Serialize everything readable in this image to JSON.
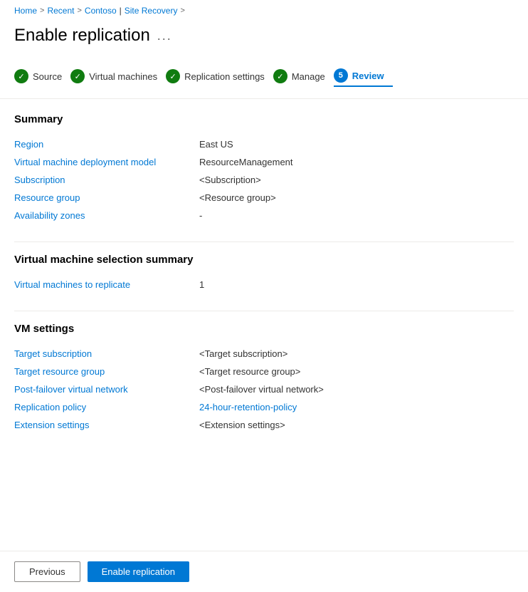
{
  "breadcrumb": {
    "home": "Home",
    "recent": "Recent",
    "contoso": "Contoso",
    "separator": ">",
    "site_recovery": "Site Recovery"
  },
  "page": {
    "title": "Enable replication",
    "menu_icon": "..."
  },
  "wizard": {
    "steps": [
      {
        "id": "source",
        "label": "Source",
        "state": "complete"
      },
      {
        "id": "virtual-machines",
        "label": "Virtual machines",
        "state": "complete"
      },
      {
        "id": "replication-settings",
        "label": "Replication settings",
        "state": "complete"
      },
      {
        "id": "manage",
        "label": "Manage",
        "state": "complete"
      },
      {
        "id": "review",
        "label": "Review",
        "state": "active",
        "number": "5"
      }
    ]
  },
  "summary_section": {
    "header": "Summary",
    "fields": [
      {
        "label": "Region",
        "value": "East US",
        "value_type": "text"
      },
      {
        "label": "Virtual machine deployment model",
        "value": "ResourceManagement",
        "value_type": "text"
      },
      {
        "label": "Subscription",
        "value": "<Subscription>",
        "value_type": "text"
      },
      {
        "label": "Resource group",
        "value": "<Resource group>",
        "value_type": "text"
      },
      {
        "label": "Availability zones",
        "value": "-",
        "value_type": "text"
      }
    ]
  },
  "vm_selection_section": {
    "header": "Virtual machine selection summary",
    "fields": [
      {
        "label": "Virtual machines to replicate",
        "value": "1",
        "value_type": "text"
      }
    ]
  },
  "vm_settings_section": {
    "header": "VM settings",
    "fields": [
      {
        "label": "Target subscription",
        "value": "<Target subscription>",
        "value_type": "text"
      },
      {
        "label": "Target resource group",
        "value": "<Target resource group>",
        "value_type": "text"
      },
      {
        "label": "Post-failover virtual network",
        "value": "<Post-failover virtual network>",
        "value_type": "text"
      },
      {
        "label": "Replication policy",
        "value": "24-hour-retention-policy",
        "value_type": "link"
      },
      {
        "label": "Extension settings",
        "value": "<Extension settings>",
        "value_type": "text"
      }
    ]
  },
  "buttons": {
    "previous": "Previous",
    "enable": "Enable replication"
  }
}
